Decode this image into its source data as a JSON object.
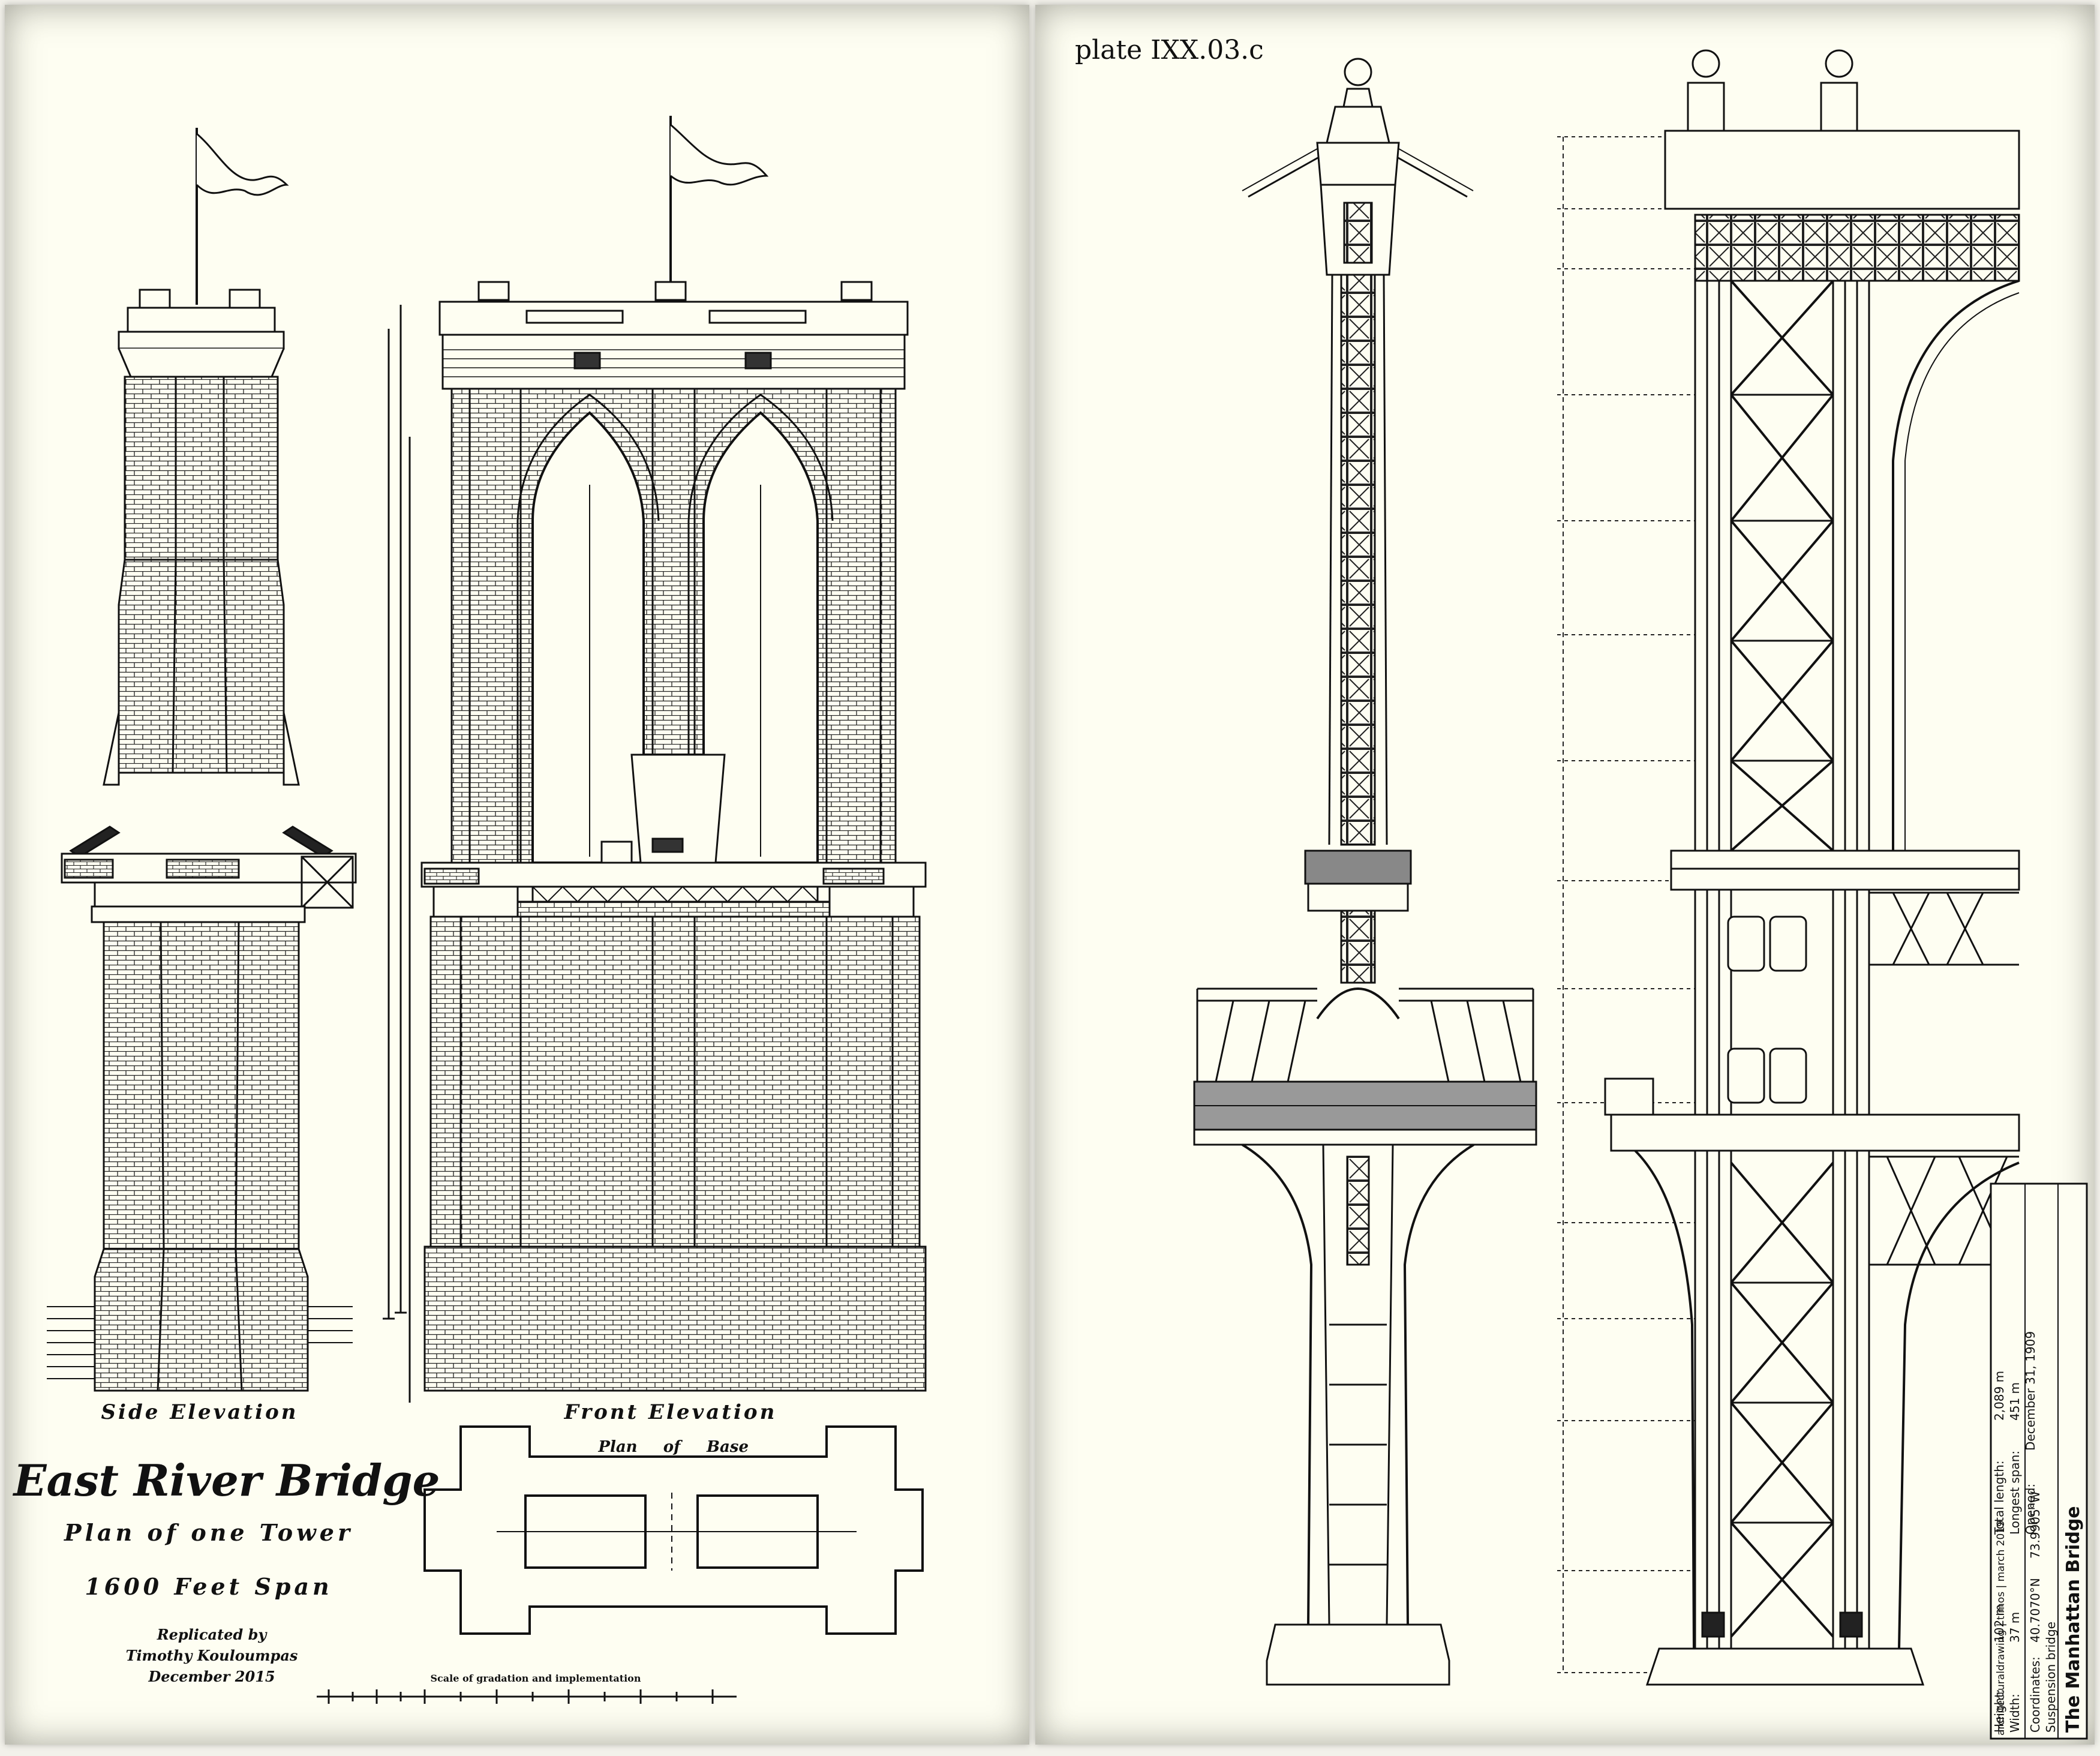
{
  "left": {
    "side_elevation": "Side Elevation",
    "front_elevation": "Front Elevation",
    "plan_of_base_1": "Plan",
    "plan_of_base_2": "of",
    "plan_of_base_3": "Base",
    "title": "East River Bridge",
    "subtitle": "Plan of one Tower",
    "span": "1600 Feet Span",
    "credit_1": "Replicated by",
    "credit_2": "Timothy Kouloumpas",
    "credit_3": "December 2015",
    "scale_caption": "Scale of gradation and implementation"
  },
  "right": {
    "plate": "plate IXX.03.c",
    "titleblock": {
      "name": "The Manhattan Bridge",
      "coords_label": "Coordinates:",
      "coords_n": "40.7070°N",
      "coords_w": "73.9905°W",
      "type": "Suspension bridge",
      "total_length_label": "Total length:",
      "total_length": "2,089 m",
      "height_label": "Height:",
      "height": "102 m",
      "longest_span_label": "Longest span:",
      "longest_span": "451 m",
      "width_label": "Width:",
      "width": "37 m",
      "opened_label": "Opened:",
      "opened": "December 31, 1909",
      "footer": "architecturaldrawing | timos | march 2019"
    }
  }
}
